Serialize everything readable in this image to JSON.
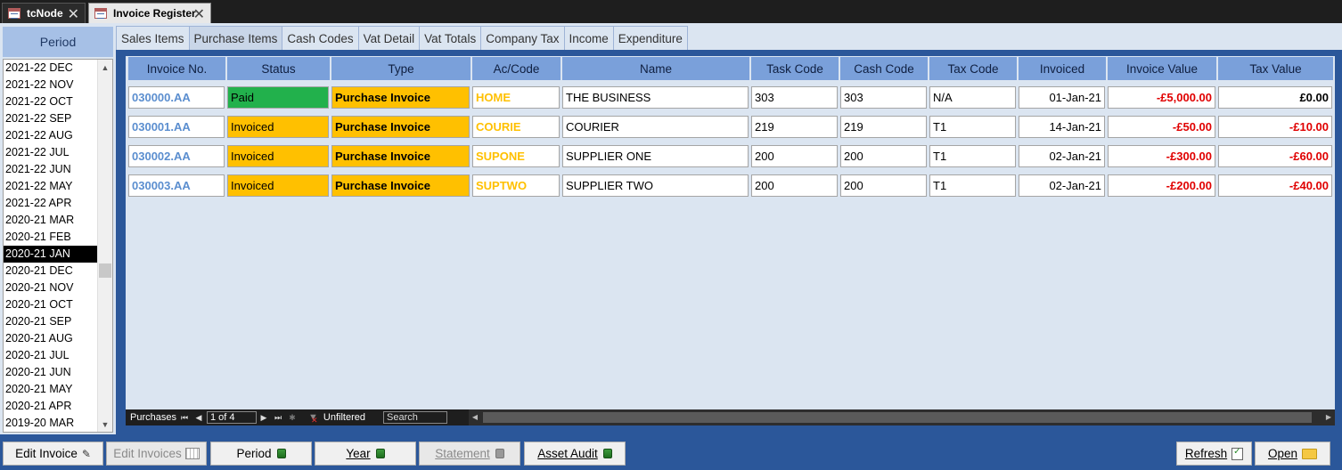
{
  "doc_tabs": [
    {
      "label": "tcNode",
      "active": false
    },
    {
      "label": "Invoice Register",
      "active": true
    }
  ],
  "period_panel": {
    "header": "Period",
    "items": [
      "2021-22 DEC",
      "2021-22 NOV",
      "2021-22 OCT",
      "2021-22 SEP",
      "2021-22 AUG",
      "2021-22 JUL",
      "2021-22 JUN",
      "2021-22 MAY",
      "2021-22 APR",
      "2020-21 MAR",
      "2020-21 FEB",
      "2020-21 JAN",
      "2020-21 DEC",
      "2020-21 NOV",
      "2020-21 OCT",
      "2020-21 SEP",
      "2020-21 AUG",
      "2020-21 JUL",
      "2020-21 JUN",
      "2020-21 MAY",
      "2020-21 APR",
      "2019-20 MAR"
    ],
    "selected": "2020-21 JAN"
  },
  "sub_tabs": [
    {
      "label": "Sales Items",
      "active": false
    },
    {
      "label": "Purchase Items",
      "active": true
    },
    {
      "label": "Cash Codes",
      "active": false
    },
    {
      "label": "Vat Detail",
      "active": false
    },
    {
      "label": "Vat Totals",
      "active": false
    },
    {
      "label": "Company Tax",
      "active": false
    },
    {
      "label": "Income",
      "active": false
    },
    {
      "label": "Expenditure",
      "active": false
    }
  ],
  "grid": {
    "columns": [
      "Invoice No.",
      "Status",
      "Type",
      "Ac/Code",
      "Name",
      "Task Code",
      "Cash Code",
      "Tax Code",
      "Invoiced",
      "Invoice Value",
      "Tax Value"
    ],
    "rows": [
      {
        "invoice_no": "030000.AA",
        "status": "Paid",
        "type": "Purchase Invoice",
        "ac_code": "HOME",
        "name": "THE BUSINESS",
        "task_code": "303",
        "cash_code": "303",
        "tax_code": "N/A",
        "invoiced": "01-Jan-21",
        "invoice_value": "-£5,000.00",
        "tax_value": "£0.00"
      },
      {
        "invoice_no": "030001.AA",
        "status": "Invoiced",
        "type": "Purchase Invoice",
        "ac_code": "COURIE",
        "name": "COURIER",
        "task_code": "219",
        "cash_code": "219",
        "tax_code": "T1",
        "invoiced": "14-Jan-21",
        "invoice_value": "-£50.00",
        "tax_value": "-£10.00"
      },
      {
        "invoice_no": "030002.AA",
        "status": "Invoiced",
        "type": "Purchase Invoice",
        "ac_code": "SUPONE",
        "name": "SUPPLIER ONE",
        "task_code": "200",
        "cash_code": "200",
        "tax_code": "T1",
        "invoiced": "02-Jan-21",
        "invoice_value": "-£300.00",
        "tax_value": "-£60.00"
      },
      {
        "invoice_no": "030003.AA",
        "status": "Invoiced",
        "type": "Purchase Invoice",
        "ac_code": "SUPTWO",
        "name": "SUPPLIER TWO",
        "task_code": "200",
        "cash_code": "200",
        "tax_code": "T1",
        "invoiced": "02-Jan-21",
        "invoice_value": "-£200.00",
        "tax_value": "-£40.00"
      }
    ]
  },
  "nav": {
    "label": "Purchases",
    "record": "1 of 4",
    "filter": "Unfiltered",
    "search": "Search"
  },
  "buttons": {
    "edit_invoice": "Edit Invoice",
    "edit_invoices": "Edit Invoices",
    "period": "Period",
    "year": "Year",
    "statement": "Statement",
    "asset_audit": "Asset Audit",
    "refresh": "Refresh",
    "open": "Open"
  },
  "colors": {
    "paid": "#22b14c",
    "invoiced": "#ffc000",
    "negative": "#e00000",
    "invoice_no": "#5b8ecf",
    "header": "#7aa0da",
    "frame": "#2b579a"
  }
}
